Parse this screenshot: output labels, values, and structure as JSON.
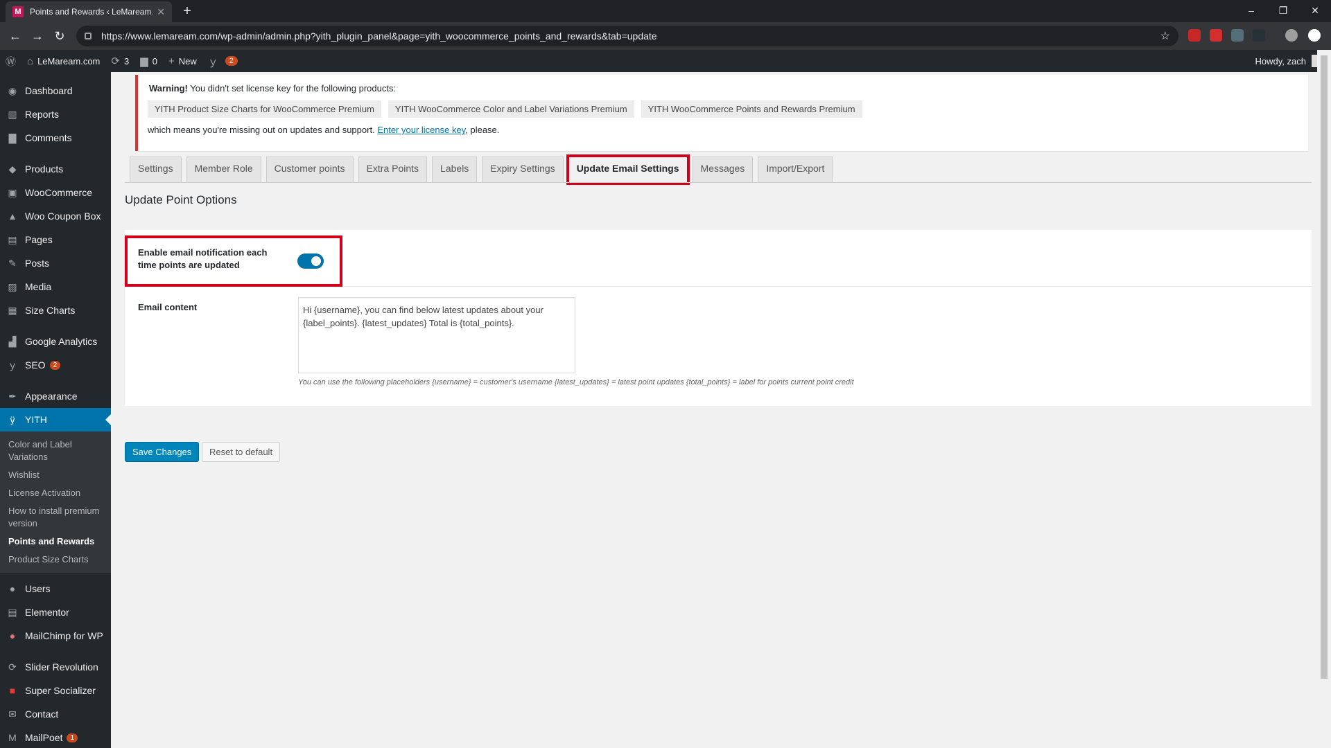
{
  "browser": {
    "tab_title": "Points and Rewards ‹ LeMaream.",
    "tab_favicon": "M",
    "url": "https://www.lemaream.com/wp-admin/admin.php?yith_plugin_panel&page=yith_woocommerce_points_and_rewards&tab=update"
  },
  "adminbar": {
    "site_name": "LeMaream.com",
    "updates_count": "3",
    "comments_count": "0",
    "new_label": "New",
    "yoast_count": "2",
    "howdy": "Howdy, zach"
  },
  "sidebar": {
    "items": [
      {
        "label": "Dashboard",
        "icon": "dashboard-icon"
      },
      {
        "label": "Reports",
        "icon": "reports-icon"
      },
      {
        "label": "Comments",
        "icon": "comments-icon"
      },
      {
        "label": "Products",
        "icon": "products-icon"
      },
      {
        "label": "WooCommerce",
        "icon": "woocommerce-icon"
      },
      {
        "label": "Woo Coupon Box",
        "icon": "coupon-icon"
      },
      {
        "label": "Pages",
        "icon": "pages-icon"
      },
      {
        "label": "Posts",
        "icon": "posts-icon"
      },
      {
        "label": "Media",
        "icon": "media-icon"
      },
      {
        "label": "Size Charts",
        "icon": "size-charts-icon"
      },
      {
        "label": "Google Analytics",
        "icon": "analytics-icon"
      },
      {
        "label": "SEO",
        "icon": "seo-icon",
        "badge": "2"
      },
      {
        "label": "Appearance",
        "icon": "appearance-icon"
      },
      {
        "label": "YITH",
        "icon": "yith-icon"
      }
    ],
    "yith_sub": [
      "Color and Label Variations",
      "Wishlist",
      "License Activation",
      "How to install premium version",
      "Points and Rewards",
      "Product Size Charts"
    ],
    "after": [
      {
        "label": "Users",
        "icon": "users-icon"
      },
      {
        "label": "Elementor",
        "icon": "elementor-icon"
      },
      {
        "label": "MailChimp for WP",
        "icon": "mailchimp-icon"
      },
      {
        "label": "Slider Revolution",
        "icon": "slider-icon"
      },
      {
        "label": "Super Socializer",
        "icon": "socializer-icon"
      },
      {
        "label": "Contact",
        "icon": "contact-icon"
      },
      {
        "label": "MailPoet",
        "icon": "mailpoet-icon",
        "badge": "1"
      }
    ]
  },
  "notice": {
    "warning_bold": "Warning!",
    "warning_text": "You didn't set license key for the following products:",
    "products": [
      "YITH Product Size Charts for WooCommerce Premium",
      "YITH WooCommerce Color and Label Variations Premium",
      "YITH WooCommerce Points and Rewards Premium"
    ],
    "missing_text": "which means you're missing out on updates and support.",
    "link_text": "Enter your license key",
    "please": ", please."
  },
  "tabs": [
    "Settings",
    "Member Role",
    "Customer points",
    "Extra Points",
    "Labels",
    "Expiry Settings",
    "Update Email Settings",
    "Messages",
    "Import/Export"
  ],
  "active_tab": "Update Email Settings",
  "section_title": "Update Point Options",
  "option": {
    "label": "Enable email notification each time points are updated",
    "enabled": true
  },
  "email": {
    "label": "Email content",
    "content": "Hi {username}, you can find below latest updates about your {label_points}. {latest_updates} Total is {total_points}.",
    "hint": "You can use the following placeholders {username} = customer's username {latest_updates} = latest point updates {total_points} = label for points current point credit"
  },
  "buttons": {
    "save": "Save Changes",
    "reset": "Reset to default"
  },
  "colors": {
    "accent": "#0073aa",
    "highlight": "#d0021b",
    "sidebar": "#23282d"
  }
}
